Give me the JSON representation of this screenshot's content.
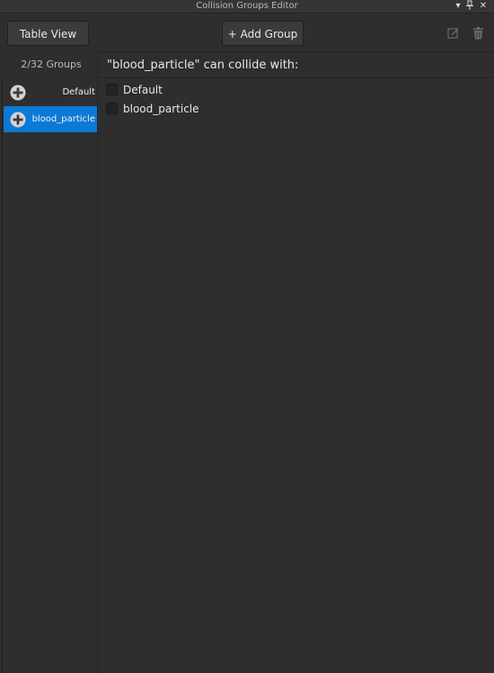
{
  "window": {
    "title": "Collision Groups Editor",
    "controls": {
      "dropdown_glyph": "▾",
      "pin_glyph": "⊥",
      "close_glyph": "✕"
    }
  },
  "toolbar": {
    "table_view_label": "Table View",
    "add_group_label": "+ Add Group",
    "icons": [
      "edit-icon",
      "trash-icon"
    ]
  },
  "sidebar": {
    "count_label": "2/32 Groups",
    "groups": [
      {
        "name": "Default",
        "selected": false
      },
      {
        "name": "blood_particle",
        "selected": true
      }
    ]
  },
  "main": {
    "header": "\"blood_particle\" can collide with:",
    "options": [
      {
        "label": "Default",
        "checked": false
      },
      {
        "label": "blood_particle",
        "checked": false
      }
    ]
  },
  "colors": {
    "background": "#2e2e2e",
    "accent_selected": "#0b79d6",
    "button": "#3b3b3b",
    "text": "#e8e8e8"
  }
}
